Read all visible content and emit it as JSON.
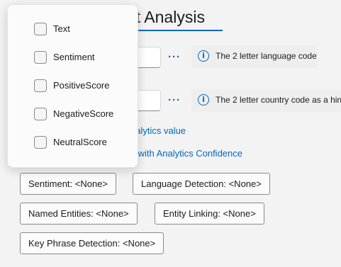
{
  "page": {
    "title": "Text Analysis",
    "more_glyph": "···",
    "info_glyph": "i"
  },
  "fields": [
    {
      "info_text": "The 2 letter language code"
    },
    {
      "info_text": "The 2 letter country code as a hin"
    }
  ],
  "links": {
    "analytics_value": "nalytics value",
    "analytics_confidence": "nce with Analytics Confidence"
  },
  "buttons": {
    "sentiment": "Sentiment:  <None>",
    "language_detection": "Language Detection:  <None>",
    "named_entities": "Named Entities:  <None>",
    "entity_linking": "Entity Linking:  <None>",
    "key_phrase_detection": "Key Phrase Detection:  <None>"
  },
  "dropdown": {
    "options": [
      "Text",
      "Sentiment",
      "PositiveScore",
      "NegativeScore",
      "NeutralScore"
    ]
  },
  "colors": {
    "accent": "#0067c0",
    "background": "#f3f3f3"
  },
  "icons": {
    "more": "more-options-icon",
    "info": "info-icon",
    "checkbox": "checkbox-unchecked"
  }
}
